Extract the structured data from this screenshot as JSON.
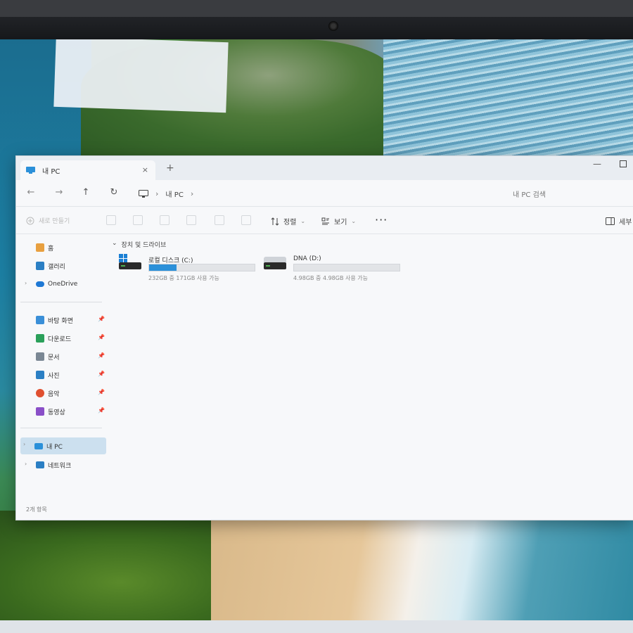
{
  "window": {
    "tab_title": "내 PC",
    "tab_close": "×",
    "new_tab": "+",
    "minimize": "—"
  },
  "nav": {
    "back": "←",
    "forward": "→",
    "up": "↑",
    "refresh": "↻",
    "breadcrumb_sep": "›",
    "breadcrumb": "내 PC",
    "search_placeholder": "내 PC 검색"
  },
  "toolbar": {
    "new_label": "새로 만들기",
    "sort_label": "정렬",
    "view_label": "보기",
    "more_label": "···",
    "details_label": "세부",
    "chevron": "⌄"
  },
  "sidebar": {
    "items": [
      {
        "label": "홈",
        "icon": "home-icon"
      },
      {
        "label": "갤러리",
        "icon": "gallery-icon"
      },
      {
        "label": "OneDrive",
        "icon": "onedrive-icon"
      },
      {
        "label": "바탕 화면",
        "icon": "desktop-icon"
      },
      {
        "label": "다운로드",
        "icon": "download-icon"
      },
      {
        "label": "문서",
        "icon": "documents-icon"
      },
      {
        "label": "사진",
        "icon": "pictures-icon"
      },
      {
        "label": "음악",
        "icon": "music-icon"
      },
      {
        "label": "동영상",
        "icon": "videos-icon"
      },
      {
        "label": "내 PC",
        "icon": "pc-icon"
      },
      {
        "label": "네트워크",
        "icon": "network-icon"
      }
    ],
    "pin": "📌",
    "expand": "›"
  },
  "content": {
    "section_toggle": "⌄",
    "section_title": "장치 및 드라이브",
    "drives": [
      {
        "name": "로컬 디스크 (C:)",
        "info": "232GB 중 171GB 사용 가능",
        "used_fraction": 0.26
      },
      {
        "name": "DNA (D:)",
        "info": "4.98GB 중 4.98GB 사용 가능",
        "used_fraction": 0.0
      }
    ]
  },
  "status": {
    "item_count": "2개 항목"
  },
  "colors": {
    "accent": "#2b90d9",
    "selected": "#cce0ef",
    "window_bg": "#f7f8fa"
  }
}
